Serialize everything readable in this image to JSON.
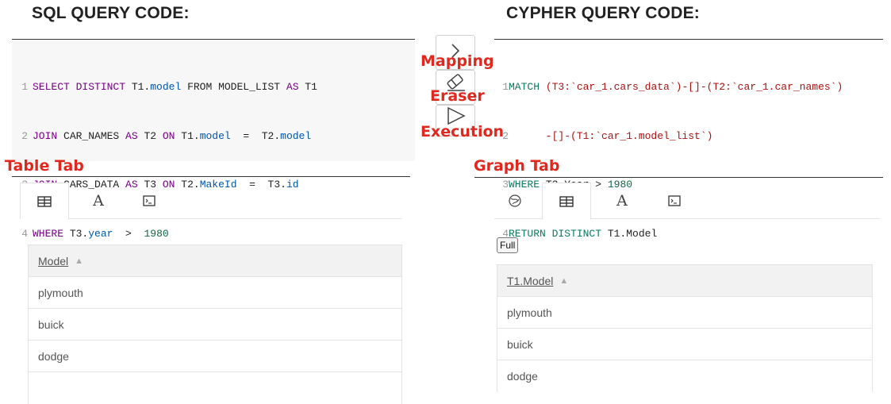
{
  "headings": {
    "sql": "SQL QUERY CODE:",
    "cypher": "CYPHER QUERY CODE:"
  },
  "sql_code": {
    "lines": [
      {
        "num": "1",
        "parts": [
          "SELECT DISTINCT",
          " T1.",
          "model",
          " FROM MODEL_LIST ",
          "AS",
          " T1"
        ]
      },
      {
        "num": "2",
        "parts": [
          "JOIN",
          " CAR_NAMES ",
          "AS",
          " T2 ",
          "ON",
          " T1.",
          "model",
          "  =  T2.",
          "model"
        ]
      },
      {
        "num": "3",
        "parts": [
          "JOIN",
          " CARS_DATA ",
          "AS",
          " T3 ",
          "ON",
          " T2.",
          "MakeId",
          "  =  T3.",
          "id"
        ]
      },
      {
        "num": "4",
        "parts": [
          "WHERE",
          " T3.",
          "year",
          "  >  ",
          "1980"
        ]
      }
    ]
  },
  "cypher_code": {
    "lines": [
      {
        "num": "1",
        "parts": [
          "MATCH",
          " (T3:`car_1.cars_data`)-[]-(T2:`car_1.car_names`)"
        ]
      },
      {
        "num": "2",
        "parts": [
          "      -[]-(T1:`car_1.model_list`)"
        ]
      },
      {
        "num": "3",
        "parts": [
          "WHERE",
          " T3.Year > ",
          "1980"
        ]
      },
      {
        "num": "4",
        "parts": [
          "RETURN DISTINCT",
          " T1.Model"
        ]
      }
    ]
  },
  "annotations": {
    "mapping": "Mapping",
    "eraser": "Eraser",
    "execution": "Execution",
    "table_tab": "Table Tab",
    "graph_tab": "Graph Tab"
  },
  "side_buttons": [
    "chevron-right-icon",
    "eraser-icon",
    "play-icon"
  ],
  "left_tabs": [
    "table-icon",
    "text-icon",
    "terminal-icon"
  ],
  "right_tabs": [
    "graph-icon",
    "table-icon",
    "text-icon",
    "terminal-icon"
  ],
  "left_table": {
    "header": "Model",
    "rows": [
      "plymouth",
      "buick",
      "dodge"
    ]
  },
  "right_table": {
    "full_button": "Full",
    "header": "T1.Model",
    "rows": [
      "plymouth",
      "buick",
      "dodge"
    ]
  },
  "colors": {
    "annotation_red": "#e0281e",
    "keyword_purple": "#770088",
    "property_blue": "#0055aa",
    "number_green": "#116644",
    "cypher_green": "#0a7a5f"
  }
}
